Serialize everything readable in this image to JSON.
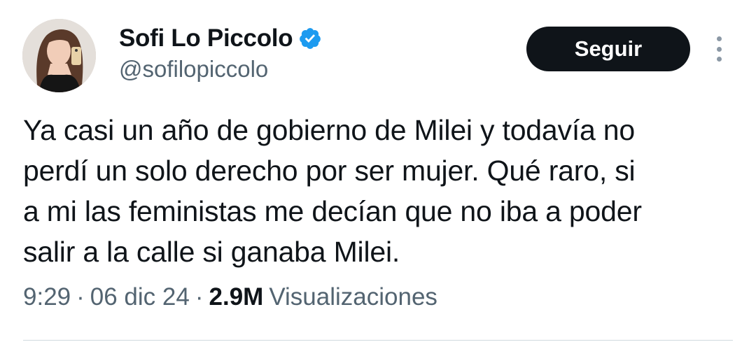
{
  "author": {
    "display_name": "Sofi Lo Piccolo",
    "handle": "@sofilopiccolo",
    "verified": true,
    "avatar_icon": "profile-photo",
    "verified_icon": "verified-badge-icon",
    "verified_color": "#1d9bf0"
  },
  "actions": {
    "follow_label": "Seguir",
    "more_icon": "more-vertical-icon"
  },
  "tweet": {
    "text": "Ya casi un año de gobierno de Milei y todavía no\nperdí un solo derecho por ser mujer. Qué raro, si\na mi las feministas me decían que no iba a poder\nsalir a la calle si ganaba Milei."
  },
  "meta": {
    "time": "9:29",
    "separator": "·",
    "date": "06 dic 24",
    "views_count": "2.9M",
    "views_label": "Visualizaciones"
  }
}
